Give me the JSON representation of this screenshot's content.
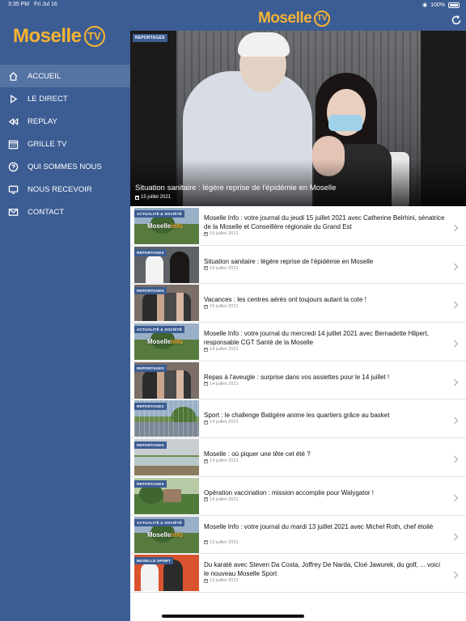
{
  "status_bar": {
    "time": "3:35 PM",
    "date": "Fri Jul 16",
    "battery": "100%"
  },
  "app": {
    "logo_text": "Moselle",
    "logo_tv": "TV"
  },
  "sidebar": {
    "items": [
      {
        "label": "ACCUEIL",
        "icon": "home-icon",
        "active": true
      },
      {
        "label": "LE DIRECT",
        "icon": "play-icon",
        "active": false
      },
      {
        "label": "REPLAY",
        "icon": "rewind-icon",
        "active": false
      },
      {
        "label": "GRILLE TV",
        "icon": "calendar-grid-icon",
        "active": false
      },
      {
        "label": "QUI SOMMES NOUS",
        "icon": "question-circle-icon",
        "active": false
      },
      {
        "label": "NOUS RECEVOIR",
        "icon": "tv-screen-icon",
        "active": false
      },
      {
        "label": "CONTACT",
        "icon": "mail-icon",
        "active": false
      }
    ]
  },
  "header": {
    "refresh_icon": "refresh-icon"
  },
  "hero": {
    "badge": "REPORTAGES",
    "title": "Situation sanitaire : légère reprise de l'épidémie en Moselle",
    "date": "15 juillet 2021"
  },
  "articles": [
    {
      "badge": "ACTUALITÉ & SOCIÉTÉ",
      "thumb": "moselleinfo",
      "title": "Moselle Info : votre journal du jeudi 15 juillet 2021 avec Catherine Belrhini, sénatrice de la Moselle et Conseillère régionale du Grand Est",
      "date": "15 juillet 2021"
    },
    {
      "badge": "REPORTAGES",
      "thumb": "vaccine",
      "title": "Situation sanitaire : légère reprise de l'épidémie en Moselle",
      "date": "15 juillet 2021"
    },
    {
      "badge": "REPORTAGES",
      "thumb": "people",
      "title": "Vacances : les centres aérés ont toujours autant la cote !",
      "date": "15 juillet 2021"
    },
    {
      "badge": "ACTUALITÉ & SOCIÉTÉ",
      "thumb": "moselleinfo",
      "title": "Moselle Info : votre journal du mercredi 14 juillet 2021 avec Bernadette Hilpert, responsable CGT Santé de la Moselle",
      "date": "14 juillet 2021"
    },
    {
      "badge": "REPORTAGES",
      "thumb": "people",
      "title": "Repas à l'aveugle : surprise dans vos assiettes pour le 14 juillet !",
      "date": "14 juillet 2021"
    },
    {
      "badge": "REPORTAGES",
      "thumb": "court",
      "title": "Sport : le challenge Batigère anime les quartiers grâce au basket",
      "date": "14 juillet 2021"
    },
    {
      "badge": "REPORTAGES",
      "thumb": "lake",
      "title": "Moselle : où piquer une tête cet été ?",
      "date": "14 juillet 2021"
    },
    {
      "badge": "REPORTAGES",
      "thumb": "park",
      "title": "Opération vaccination : mission accomplie pour Walygator !",
      "date": "14 juillet 2021"
    },
    {
      "badge": "ACTUALITÉ & SOCIÉTÉ",
      "thumb": "moselleinfo",
      "title": "Moselle Info : votre journal du mardi 13 juillet 2021 avec Michel Roth, chef étoilé",
      "date": "13 juillet 2021"
    },
    {
      "badge": "MOSELLE SPORT",
      "thumb": "sport",
      "title": "Du karaté avec Steven Da Costa, Joffrey De Narda, Cloé Jawurek, du golf, ... voici le nouveau Moselle Sport",
      "date": "13 juillet 2021"
    }
  ],
  "thumb_text": {
    "moselle": "Moselle",
    "info": "info"
  },
  "colors": {
    "brand_blue": "#3c5d93",
    "brand_yellow": "#f6b333",
    "active_nav": "#5573a3"
  }
}
